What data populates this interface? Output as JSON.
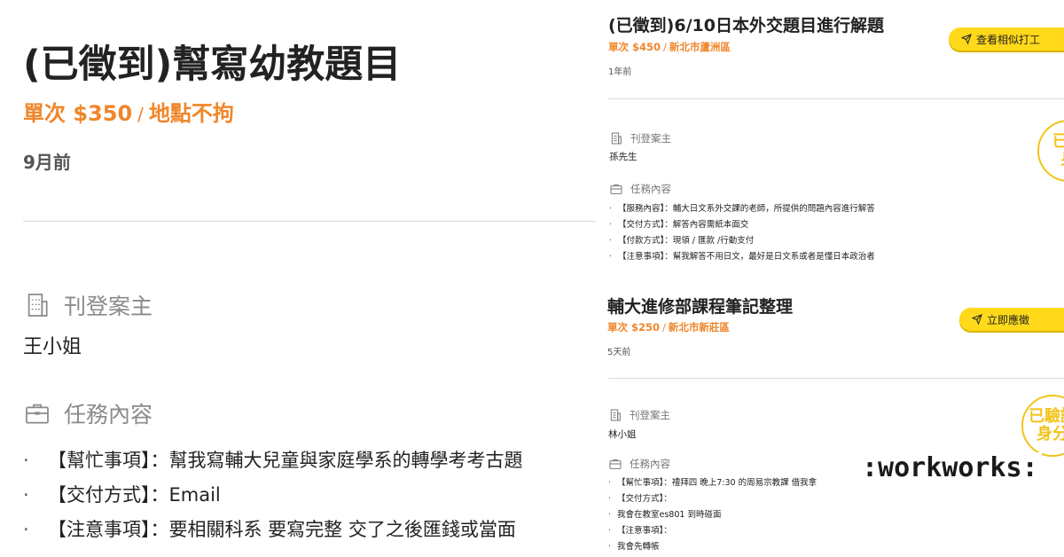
{
  "left": {
    "title": "(已徵到)幫寫幼教題目",
    "price": "單次 $350",
    "separator": "/",
    "location": "地點不拘",
    "time": "9月前",
    "poster_label": "刊登案主",
    "poster_name": "王小姐",
    "task_label": "任務內容",
    "items": [
      "【幫忙事項】：幫我寫輔大兒童與家庭學系的轉學考考古題",
      "【交付方式】：Email",
      "【注意事項】：要相關科系 要寫完整 交了之後匯錢或當面"
    ]
  },
  "card1": {
    "title": "(已徵到)6/10日本外交題目進行解題",
    "price": "單次 $450",
    "separator": "/",
    "location": "新北市蘆洲區",
    "time": "1年前",
    "button": "查看相似打工",
    "poster_label": "刊登案主",
    "poster_name": "孫先生",
    "task_label": "任務內容",
    "badge_top": "已驗",
    "badge_bottom": "身",
    "items": [
      "【服務內容】：輔大日文系外交課的老師，所提供的問題內容進行解答",
      "【交付方式】：解答內容需紙本面交",
      "【付款方式】：現領 / 匯款 /行動支付",
      "【注意事項】：幫我解答不用日文，最好是日文系或者是懂日本政治者"
    ]
  },
  "card2": {
    "title": "輔大進修部課程筆記整理",
    "price": "單次 $250",
    "separator": "/",
    "location": "新北市新莊區",
    "time": "5天前",
    "button": "立即應徵",
    "poster_label": "刊登案主",
    "poster_name": "林小姐",
    "task_label": "任務內容",
    "badge_top": "已驗證",
    "badge_bottom": "身分",
    "items": [
      "【幫忙事項】：禮拜四 晚上7:30 的周易宗教課 借我拿",
      "【交付方式】：",
      "我會在教室es801 到時碰面",
      "【注意事項】：",
      "我會先轉帳"
    ]
  },
  "watermark": ":workworks:",
  "colors": {
    "accent": "#f0862a",
    "button": "#ffd91a",
    "badge": "#f2c31a"
  }
}
